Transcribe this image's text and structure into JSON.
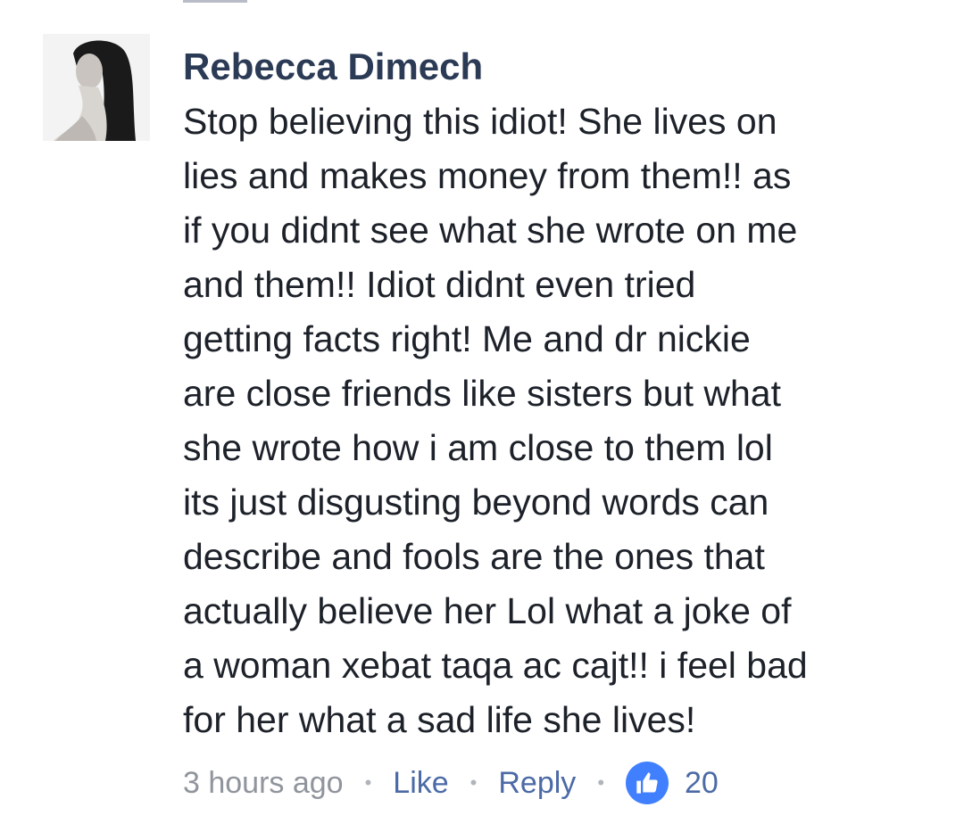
{
  "comment": {
    "author": "Rebecca Dimech",
    "text": "Stop believing this idiot! She lives on\nlies and makes money from them!! as\nif you didnt see what she wrote on me\nand them!! Idiot didnt even tried\ngetting facts right! Me and dr nickie\nare close friends like sisters but what\nshe wrote how i am close to them lol\nits just disgusting beyond words can\ndescribe and fools are the ones that\nactually believe her Lol what a joke of\na woman xebat taqa ac cajt!!  i feel bad\nfor her what a sad life she lives!",
    "timestamp": "3 hours ago",
    "like_label": "Like",
    "reply_label": "Reply",
    "reaction_count": "20",
    "reaction_icon": "thumbs-up-icon",
    "separator": "•"
  },
  "colors": {
    "author": "#2b3a55",
    "text": "#1d2129",
    "meta": "#90949c",
    "link": "#4b6aa6",
    "like_badge": "#4080ff"
  }
}
